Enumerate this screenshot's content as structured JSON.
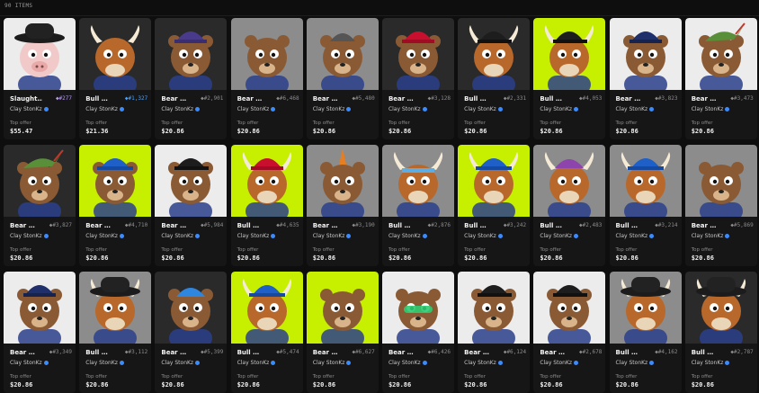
{
  "header": {
    "item_count": "90 ITEMS"
  },
  "common": {
    "creator": "Clay StonKz",
    "offer_label": "Top offer"
  },
  "colors": {
    "bg_white": "#ececec",
    "bg_grey": "#8c8c8c",
    "bg_dark": "#2a2a2a",
    "bg_lime": "#c6f000",
    "bear_fur": "#8a5a34",
    "bull_fur": "#b8682a"
  },
  "cards": [
    {
      "name": "Slaught…",
      "rank": "◆#277",
      "rank_style": "hl2",
      "price": "$55.47",
      "bg": "white",
      "animal": "pig",
      "hat": "black-cowboy"
    },
    {
      "name": "Bull …",
      "rank": "◆#1,327",
      "rank_style": "hl",
      "price": "$21.36",
      "bg": "dark",
      "animal": "bull-mix",
      "hat": "none"
    },
    {
      "name": "Bear …",
      "rank": "◆#2,901",
      "rank_style": "",
      "price": "$20.86",
      "bg": "dark",
      "animal": "bear",
      "hat": "purple-cap"
    },
    {
      "name": "Bear …",
      "rank": "◆#6,468",
      "rank_style": "",
      "price": "$20.86",
      "bg": "grey",
      "animal": "bear",
      "hat": "none"
    },
    {
      "name": "Bear …",
      "rank": "◆#5,480",
      "rank_style": "",
      "price": "$20.86",
      "bg": "grey",
      "animal": "bear",
      "hat": "beanie"
    },
    {
      "name": "Bear …",
      "rank": "◆#3,128",
      "rank_style": "",
      "price": "$20.86",
      "bg": "dark",
      "animal": "bear",
      "hat": "red-cap"
    },
    {
      "name": "Bull …",
      "rank": "◆#2,331",
      "rank_style": "",
      "price": "$20.86",
      "bg": "dark",
      "animal": "bull",
      "hat": "black-cap"
    },
    {
      "name": "Bull …",
      "rank": "◆#4,053",
      "rank_style": "",
      "price": "$20.86",
      "bg": "lime",
      "animal": "bull",
      "hat": "black-cap"
    },
    {
      "name": "Bear …",
      "rank": "◆#3,823",
      "rank_style": "",
      "price": "$20.86",
      "bg": "white",
      "animal": "bear",
      "hat": "navy-cap"
    },
    {
      "name": "Bear …",
      "rank": "◆#3,473",
      "rank_style": "",
      "price": "$20.86",
      "bg": "white",
      "animal": "bear",
      "hat": "robin-hood"
    },
    {
      "name": "Bear …",
      "rank": "◆#3,827",
      "rank_style": "",
      "price": "$20.86",
      "bg": "dark",
      "animal": "bear",
      "hat": "robin-hood"
    },
    {
      "name": "Bear …",
      "rank": "◆#4,710",
      "rank_style": "",
      "price": "$20.86",
      "bg": "lime",
      "animal": "bear",
      "hat": "blue-cap"
    },
    {
      "name": "Bear …",
      "rank": "◆#5,984",
      "rank_style": "",
      "price": "$20.86",
      "bg": "white",
      "animal": "bear",
      "hat": "black-cap"
    },
    {
      "name": "Bull …",
      "rank": "◆#4,635",
      "rank_style": "",
      "price": "$20.86",
      "bg": "lime",
      "animal": "bull",
      "hat": "red-cap"
    },
    {
      "name": "Bear …",
      "rank": "◆#3,190",
      "rank_style": "",
      "price": "$20.86",
      "bg": "grey",
      "animal": "bear",
      "hat": "mohawk"
    },
    {
      "name": "Bull …",
      "rank": "◆#2,876",
      "rank_style": "",
      "price": "$20.86",
      "bg": "grey",
      "animal": "bull",
      "hat": "headband"
    },
    {
      "name": "Bull …",
      "rank": "◆#3,242",
      "rank_style": "",
      "price": "$20.86",
      "bg": "lime",
      "animal": "bull",
      "hat": "blue-cap"
    },
    {
      "name": "Bull …",
      "rank": "◆#2,483",
      "rank_style": "",
      "price": "$20.86",
      "bg": "grey",
      "animal": "bull",
      "hat": "purple-beanie"
    },
    {
      "name": "Bull …",
      "rank": "◆#3,214",
      "rank_style": "",
      "price": "$20.86",
      "bg": "grey",
      "animal": "bull",
      "hat": "blue-cap"
    },
    {
      "name": "Bear …",
      "rank": "◆#5,869",
      "rank_style": "",
      "price": "$20.86",
      "bg": "grey",
      "animal": "bear",
      "hat": "none"
    },
    {
      "name": "Bear …",
      "rank": "◆#3,349",
      "rank_style": "",
      "price": "$20.86",
      "bg": "white",
      "animal": "bear",
      "hat": "navy-cap"
    },
    {
      "name": "Bull …",
      "rank": "◆#3,112",
      "rank_style": "",
      "price": "$20.86",
      "bg": "grey",
      "animal": "bull",
      "hat": "fedora"
    },
    {
      "name": "Bear …",
      "rank": "◆#5,399",
      "rank_style": "",
      "price": "$20.86",
      "bg": "dark",
      "animal": "bear",
      "hat": "blue-hair"
    },
    {
      "name": "Bull …",
      "rank": "◆#5,474",
      "rank_style": "",
      "price": "$20.86",
      "bg": "lime",
      "animal": "bull",
      "hat": "blue-cap"
    },
    {
      "name": "Bear …",
      "rank": "◆#6,627",
      "rank_style": "",
      "price": "$20.86",
      "bg": "lime",
      "animal": "bear",
      "hat": "none"
    },
    {
      "name": "Bear …",
      "rank": "◆#6,426",
      "rank_style": "",
      "price": "$20.86",
      "bg": "white",
      "animal": "bear",
      "hat": "visor"
    },
    {
      "name": "Bear …",
      "rank": "◆#6,124",
      "rank_style": "",
      "price": "$20.86",
      "bg": "white",
      "animal": "bear",
      "hat": "black-cap"
    },
    {
      "name": "Bear …",
      "rank": "◆#2,678",
      "rank_style": "",
      "price": "$20.86",
      "bg": "white",
      "animal": "bear",
      "hat": "black-cap"
    },
    {
      "name": "Bull …",
      "rank": "◆#4,162",
      "rank_style": "",
      "price": "$20.86",
      "bg": "grey",
      "animal": "bull",
      "hat": "black-cowboy"
    },
    {
      "name": "Bull …",
      "rank": "◆#2,787",
      "rank_style": "",
      "price": "$20.86",
      "bg": "dark",
      "animal": "bull",
      "hat": "black-cowboy"
    }
  ]
}
